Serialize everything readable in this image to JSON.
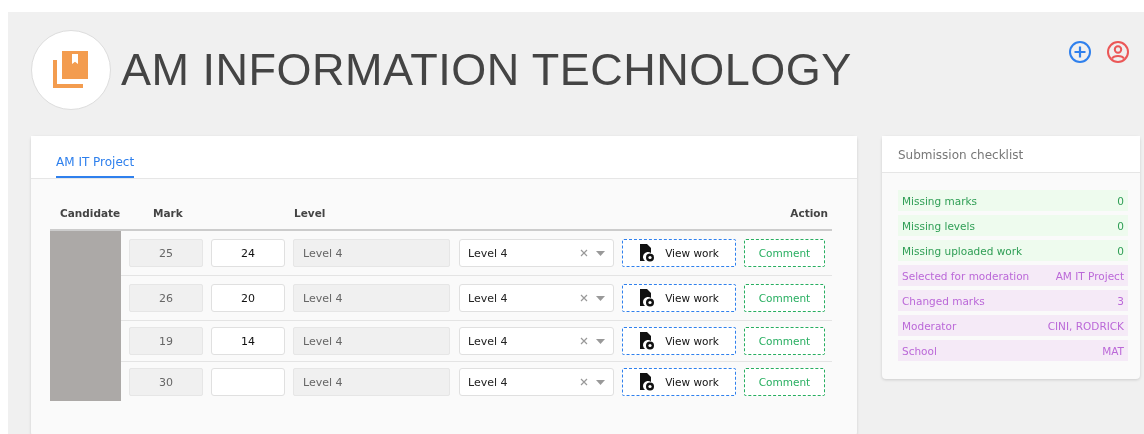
{
  "header": {
    "title": "AM INFORMATION TECHNOLOGY"
  },
  "tabs": [
    {
      "label": "AM IT Project",
      "selected": true
    }
  ],
  "table": {
    "columns": [
      "Candidate",
      "Mark",
      "Level",
      "Action"
    ],
    "rows": [
      {
        "original_mark": "25",
        "new_mark": "24",
        "original_level": "Level 4",
        "level": "Level 4",
        "view_label": "View work",
        "comment_label": "Comment"
      },
      {
        "original_mark": "26",
        "new_mark": "20",
        "original_level": "Level 4",
        "level": "Level 4",
        "view_label": "View work",
        "comment_label": "Comment"
      },
      {
        "original_mark": "19",
        "new_mark": "14",
        "original_level": "Level 4",
        "level": "Level 4",
        "view_label": "View work",
        "comment_label": "Comment"
      },
      {
        "original_mark": "30",
        "original_level": "Level 4",
        "level": "Level 4",
        "view_label": "View work",
        "comment_label": "Comment"
      }
    ]
  },
  "checklist": {
    "title": "Submission checklist",
    "items": [
      {
        "kind": "ok",
        "label": "Missing marks",
        "value": "0"
      },
      {
        "kind": "ok",
        "label": "Missing levels",
        "value": "0"
      },
      {
        "kind": "ok",
        "label": "Missing uploaded work",
        "value": "0"
      },
      {
        "kind": "info",
        "label": "Selected for moderation",
        "value": "AM IT Project"
      },
      {
        "kind": "info",
        "label": "Changed marks",
        "value": "3"
      },
      {
        "kind": "info",
        "label": "Moderator",
        "value": "CINI, RODRICK"
      },
      {
        "kind": "info",
        "label": "School",
        "value": "MAT"
      }
    ]
  }
}
